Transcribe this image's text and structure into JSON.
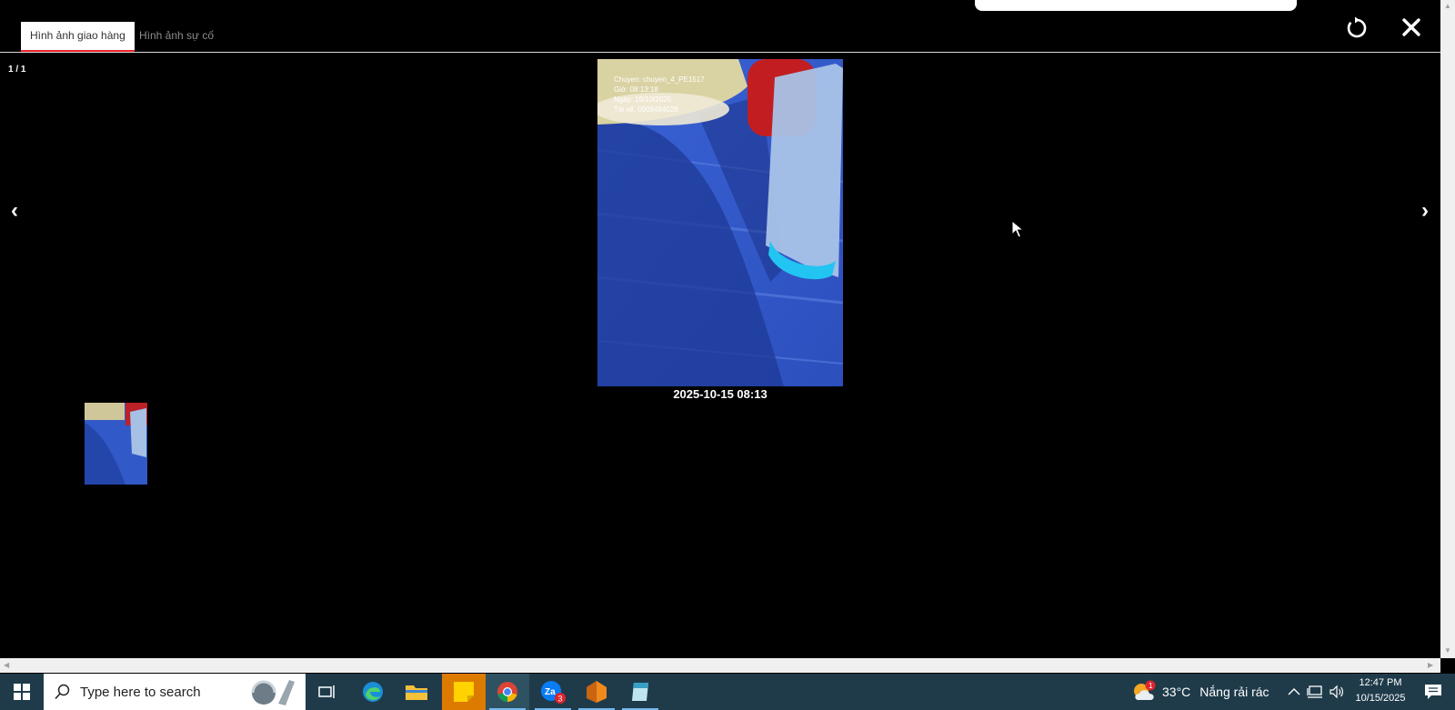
{
  "tabs": [
    {
      "label": "Hình ảnh giao hàng",
      "active": true
    },
    {
      "label": "Hình ảnh sự cố",
      "active": false
    }
  ],
  "viewer": {
    "counter": "1 / 1",
    "prev_glyph": "‹",
    "next_glyph": "›",
    "caption": "2025-10-15 08:13",
    "photo_overlay": [
      "Chuyen: chuyen_4_PE1517",
      "Giờ: 08:13:18",
      "Ngày: 15/10/2025",
      "Tài xế: 0909484028"
    ]
  },
  "taskbar": {
    "search_placeholder": "Type here to search",
    "zalo_badge": "3",
    "weather_badge": "1",
    "temperature": "33°C",
    "weather_text": "Nắng rải rác",
    "time": "12:47 PM",
    "date": "10/15/2025"
  },
  "colors": {
    "tab_active_underline": "#e8212b",
    "taskbar_bg": "#1f3b4a",
    "photo_blue": "#2f58c9"
  }
}
